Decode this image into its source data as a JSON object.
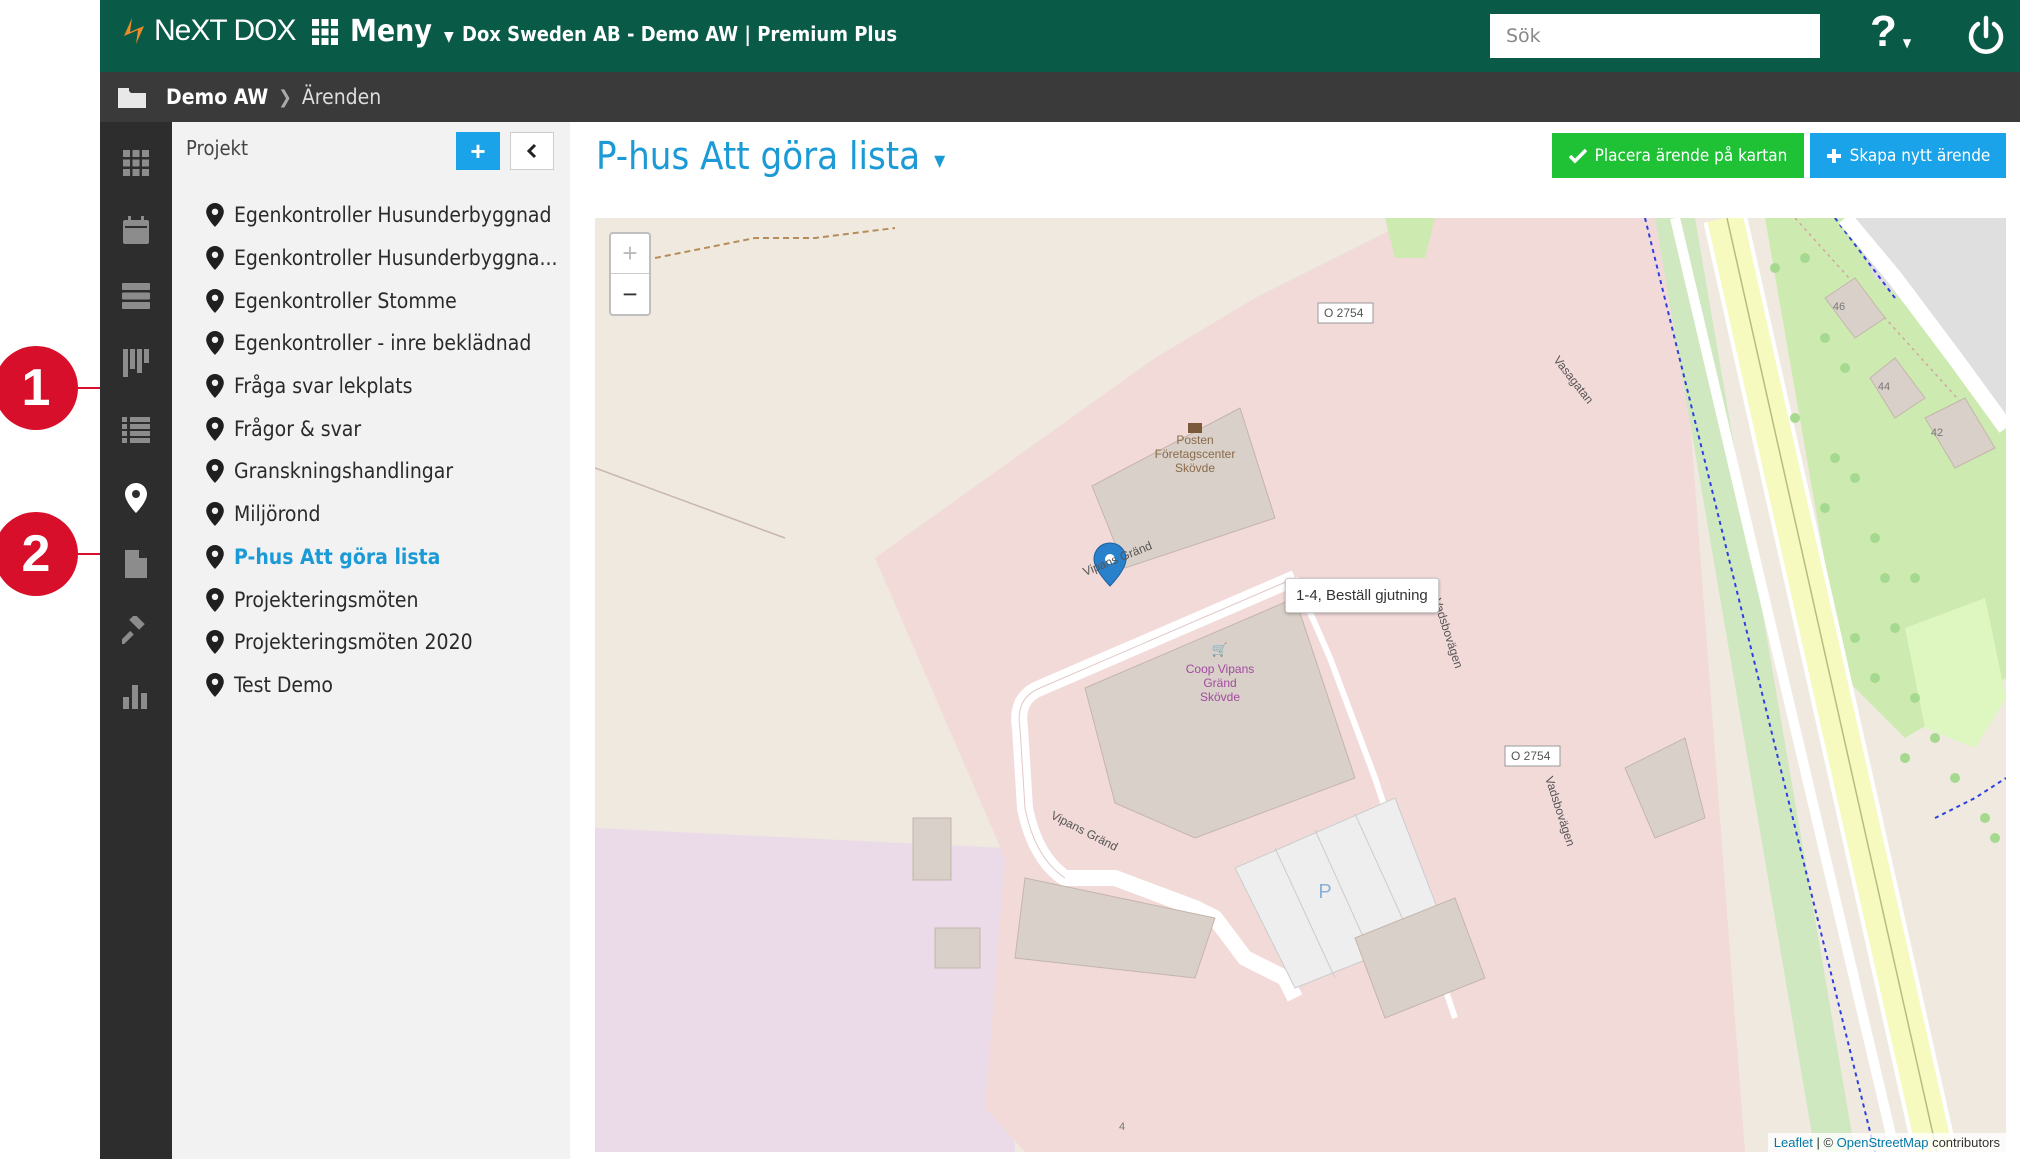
{
  "topbar": {
    "logo_text": "NeXT DOX",
    "menu_label": "Meny",
    "project_title": "Dox Sweden AB - Demo AW | Premium Plus",
    "search_placeholder": "Sök",
    "help_label": "?"
  },
  "breadcrumb": {
    "root": "Demo AW",
    "current": "Ärenden"
  },
  "rail": {
    "items": [
      "apps-icon",
      "calendar-icon",
      "server-icon",
      "kanban-icon",
      "list-icon",
      "map-marker-icon",
      "document-icon",
      "hammer-icon",
      "bar-chart-icon"
    ],
    "active": "map-marker-icon"
  },
  "callouts": {
    "one": "1",
    "two": "2"
  },
  "panel": {
    "title": "Projekt",
    "add_label": "+",
    "projects": [
      "Egenkontroller Husunderbyggnad",
      "Egenkontroller Husunderbyggna...",
      "Egenkontroller Stomme",
      "Egenkontroller - inre beklädnad",
      "Fråga svar lekplats",
      "Frågor & svar",
      "Granskningshandlingar",
      "Miljörond",
      "P-hus Att göra lista",
      "Projekteringsmöten",
      "Projekteringsmöten 2020",
      "Test Demo"
    ],
    "active_index": 8
  },
  "main": {
    "title": "P-hus Att göra lista",
    "place_button": "Placera ärende på kartan",
    "create_button": "Skapa nytt ärende"
  },
  "map": {
    "zoom_in": "+",
    "zoom_out": "−",
    "marker_label": "1-4, Beställ gjutning",
    "labels": {
      "road_badge_1": "O 2754",
      "road_badge_2": "O 2754",
      "vipans_1": "Vipans Gränd",
      "vipans_2": "Vipans Gränd",
      "vadsbo_1": "Vadsbovägen",
      "vadsbo_2": "Vadsbovägen",
      "vasagatan": "Vasagatan",
      "posten": [
        "Posten",
        "Företagscenter",
        "Skövde"
      ],
      "coop": [
        "Coop Vipans",
        "Gränd",
        "Skövde"
      ],
      "house_46": "46",
      "house_44": "44",
      "house_42": "42",
      "house_4": "4",
      "parking": "P"
    },
    "attribution_leaflet": "Leaflet",
    "attribution_sep": "| ©",
    "attribution_osm": "OpenStreetMap",
    "attribution_rest": "contributors"
  },
  "colors": {
    "topbar": "#0a5a48",
    "accent_blue": "#1aa3e8",
    "accent_green": "#1fc135",
    "callout_red": "#d80f2a"
  }
}
